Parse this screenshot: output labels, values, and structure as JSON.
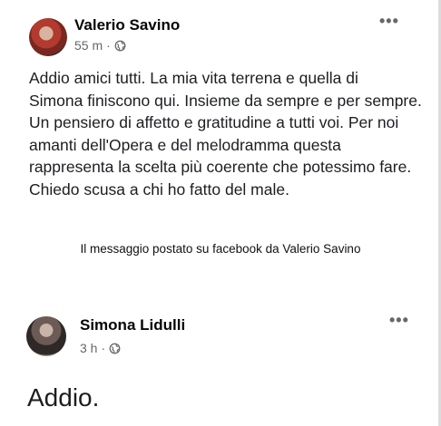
{
  "post1": {
    "author": "Valerio Savino",
    "time": "55 m",
    "separator": "·",
    "more_label": "•••",
    "text": "Addio amici tutti. La mia vita terrena e quella di\nSimona finiscono qui. Insieme da sempre e per sempre.\nUn pensiero di affetto e gratitudine a tutti voi. Per noi\namanti dell'Opera e del melodramma questa\nrappresenta la scelta più coerente che potessimo fare.\nChiedo scusa a chi ho fatto del male."
  },
  "caption": "Il messaggio postato su facebook da Valerio Savino",
  "post2": {
    "author": "Simona Lidulli",
    "time": "3 h",
    "separator": "·",
    "more_label": "•••",
    "text": "Addio."
  },
  "icons": {
    "privacy": "globe-icon",
    "menu": "more-horizontal-icon"
  },
  "colors": {
    "meta_gray": "#65676b",
    "name_black": "#050505"
  }
}
